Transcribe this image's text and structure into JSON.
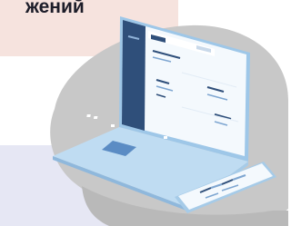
{
  "banner": {
    "headline_fragment": "жений"
  },
  "illustration": {
    "subject": "laptop-and-phone",
    "colors": {
      "blob": "#c8c8c8",
      "blob_shadow": "#b3b3b3",
      "laptop_body": "#bfdcf2",
      "laptop_screen": "#f4f9fd",
      "laptop_sidebar": "#2f4f7a",
      "accent": "#5b8cc4",
      "keyboard_lines": "#ffffff"
    }
  }
}
